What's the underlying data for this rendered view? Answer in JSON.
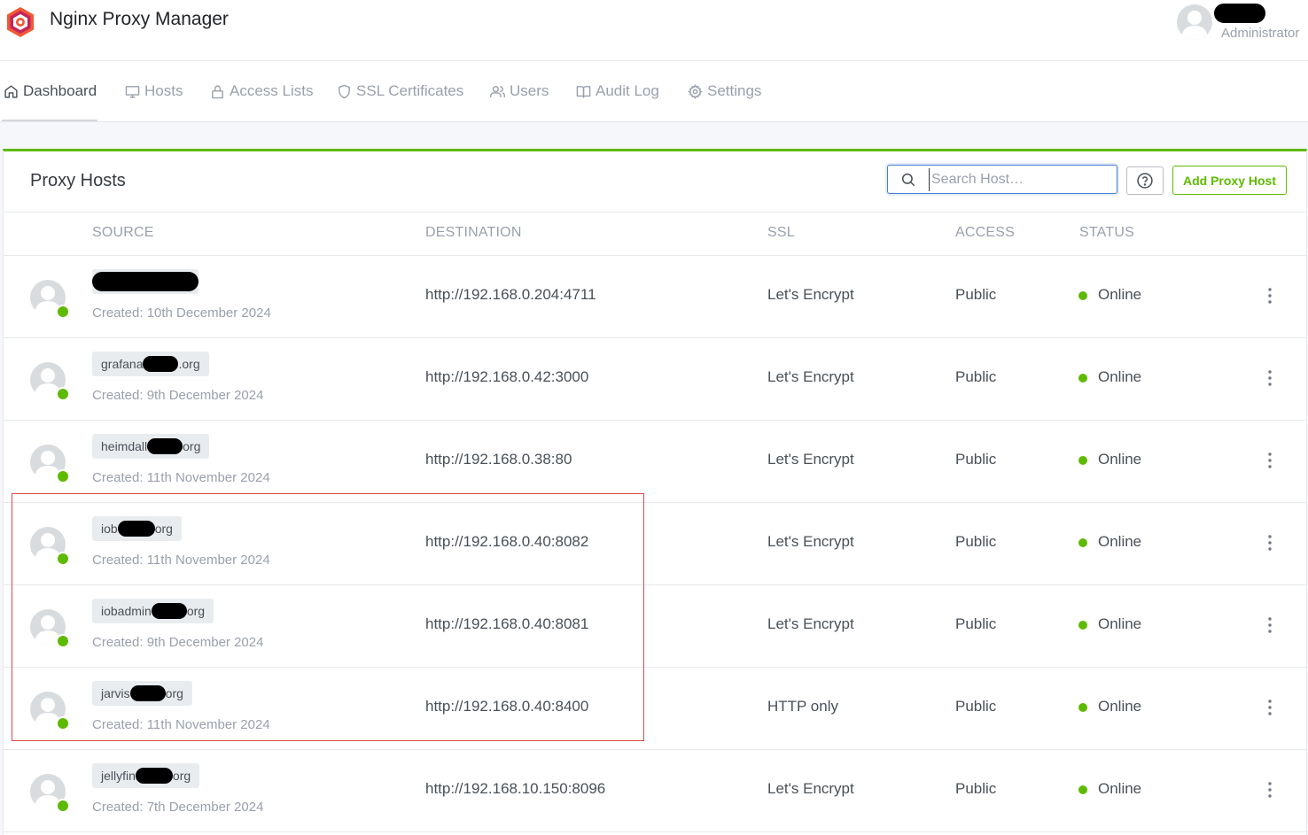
{
  "app": {
    "title": "Nginx Proxy Manager"
  },
  "user": {
    "role": "Administrator"
  },
  "nav": [
    {
      "label": "Dashboard",
      "icon": "home-icon",
      "active": true
    },
    {
      "label": "Hosts",
      "icon": "monitor-icon",
      "active": false
    },
    {
      "label": "Access Lists",
      "icon": "lock-icon",
      "active": false
    },
    {
      "label": "SSL Certificates",
      "icon": "shield-icon",
      "active": false
    },
    {
      "label": "Users",
      "icon": "users-icon",
      "active": false
    },
    {
      "label": "Audit Log",
      "icon": "book-icon",
      "active": false
    },
    {
      "label": "Settings",
      "icon": "gear-icon",
      "active": false
    }
  ],
  "card": {
    "title": "Proxy Hosts",
    "search_placeholder": "Search Host…",
    "add_button": "Add Proxy Host"
  },
  "table": {
    "columns": [
      "SOURCE",
      "DESTINATION",
      "SSL",
      "ACCESS",
      "STATUS"
    ],
    "rows": [
      {
        "domain_prefix": "",
        "domain_suffix": "",
        "created": "Created: 10th December 2024",
        "destination": "http://192.168.0.204:4711",
        "ssl": "Let's Encrypt",
        "access": "Public",
        "status": "Online"
      },
      {
        "domain_prefix": "grafana",
        "domain_suffix": ".org",
        "created": "Created: 9th December 2024",
        "destination": "http://192.168.0.42:3000",
        "ssl": "Let's Encrypt",
        "access": "Public",
        "status": "Online"
      },
      {
        "domain_prefix": "heimdall",
        "domain_suffix": "org",
        "created": "Created: 11th November 2024",
        "destination": "http://192.168.0.38:80",
        "ssl": "Let's Encrypt",
        "access": "Public",
        "status": "Online"
      },
      {
        "domain_prefix": "iob",
        "domain_suffix": "org",
        "created": "Created: 11th November 2024",
        "destination": "http://192.168.0.40:8082",
        "ssl": "Let's Encrypt",
        "access": "Public",
        "status": "Online"
      },
      {
        "domain_prefix": "iobadmin",
        "domain_suffix": "org",
        "created": "Created: 9th December 2024",
        "destination": "http://192.168.0.40:8081",
        "ssl": "Let's Encrypt",
        "access": "Public",
        "status": "Online"
      },
      {
        "domain_prefix": "jarvis",
        "domain_suffix": "org",
        "created": "Created: 11th November 2024",
        "destination": "http://192.168.0.40:8400",
        "ssl": "HTTP only",
        "access": "Public",
        "status": "Online"
      },
      {
        "domain_prefix": "jellyfin",
        "domain_suffix": "org",
        "created": "Created: 7th December 2024",
        "destination": "http://192.168.10.150:8096",
        "ssl": "Let's Encrypt",
        "access": "Public",
        "status": "Online"
      }
    ]
  },
  "colors": {
    "accent": "#5eba00",
    "highlight": "#e0474c",
    "focus": "#467fcf"
  }
}
